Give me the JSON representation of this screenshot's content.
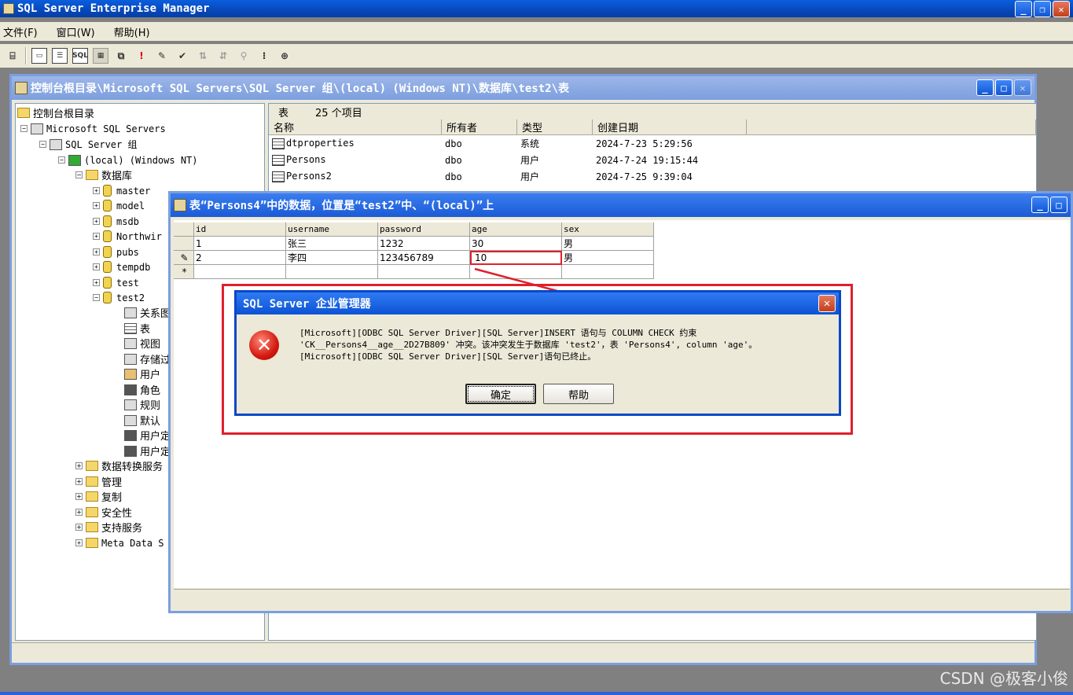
{
  "app": {
    "title": "SQL Server Enterprise Manager"
  },
  "menu": {
    "items": [
      "文件(F)",
      "窗口(W)",
      "帮助(H)"
    ]
  },
  "toolbar": {
    "icons": [
      "properties-icon",
      "list-icon",
      "detail-icon",
      "sql-icon",
      "grid-icon",
      "window-icon",
      "run-icon",
      "verify-icon",
      "check-icon",
      "sort-asc-icon",
      "sort-desc-icon",
      "filter-icon",
      "group-icon",
      "add-table-icon"
    ]
  },
  "console": {
    "title": "控制台根目录\\Microsoft SQL Servers\\SQL Server 组\\(local) (Windows NT)\\数据库\\test2\\表"
  },
  "tree": {
    "root": "控制台根目录",
    "servers": "Microsoft SQL Servers",
    "group": "SQL Server 组",
    "instance": "(local) (Windows NT)",
    "databases": "数据库",
    "dbs": [
      "master",
      "model",
      "msdb",
      "Northwir",
      "pubs",
      "tempdb",
      "test",
      "test2"
    ],
    "test2_children": [
      "关系图",
      "表",
      "视图",
      "存储过",
      "用户",
      "角色",
      "规则",
      "默认",
      "用户定",
      "用户定"
    ],
    "others": [
      "数据转换服务",
      "管理",
      "复制",
      "安全性",
      "支持服务",
      "Meta Data S"
    ]
  },
  "list": {
    "caption_label": "表",
    "caption_count": "25 个项目",
    "columns": [
      "名称",
      "所有者",
      "类型",
      "创建日期"
    ],
    "rows": [
      {
        "name": "dtproperties",
        "owner": "dbo",
        "type": "系统",
        "created": "2024-7-23 5:29:56"
      },
      {
        "name": "Persons",
        "owner": "dbo",
        "type": "用户",
        "created": "2024-7-24 19:15:44"
      },
      {
        "name": "Persons2",
        "owner": "dbo",
        "type": "用户",
        "created": "2024-7-25 9:39:04"
      }
    ]
  },
  "datawin": {
    "title": "表“Persons4”中的数据，位置是“test2”中、“(local)”上",
    "columns": [
      "id",
      "username",
      "password",
      "age",
      "sex"
    ],
    "rows": [
      {
        "marker": "",
        "id": "1",
        "username": "张三",
        "password": "1232",
        "age": "30",
        "sex": "男"
      },
      {
        "marker": "✎",
        "id": "2",
        "username": "李四",
        "password": "123456789",
        "age": "10",
        "sex": "男"
      }
    ],
    "new_row_marker": "*"
  },
  "dialog": {
    "title": "SQL Server 企业管理器",
    "line1": "[Microsoft][ODBC SQL Server Driver][SQL Server]INSERT 语句与 COLUMN CHECK 约束",
    "line2": "'CK__Persons4__age__2D27B809' 冲突。该冲突发生于数据库 'test2'，表 'Persons4', column 'age'。",
    "line3": "[Microsoft][ODBC SQL Server Driver][SQL Server]语句已终止。",
    "ok_label": "确定",
    "help_label": "帮助"
  },
  "watermark": "CSDN @极客小俊",
  "colors": {
    "highlight": "#e0202b",
    "title_active": "#0c52d4",
    "title_inactive": "#7c9fde"
  }
}
